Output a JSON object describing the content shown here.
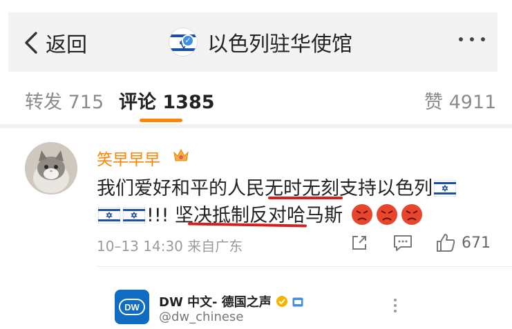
{
  "header": {
    "back_label": "返回",
    "title": "以色列驻华使馆",
    "more_icon": "more-dots-icon"
  },
  "tabs": [
    {
      "label": "转发 715"
    },
    {
      "label": "评论 1385"
    },
    {
      "label": "赞 4911"
    }
  ],
  "comment": {
    "username": "笑早早早",
    "line1_text": "我们爱好和平的人民无时无刻支持以色列",
    "line2_text": "!!! 坚决抵制反对哈马斯",
    "time": "10–13 14:30",
    "location": "来自广东",
    "like_count": "671"
  },
  "card": {
    "name": "DW 中文- 德国之声",
    "handle": "@dw_chinese",
    "logo_text": "DW"
  },
  "colors": {
    "accent": "#ff8200",
    "underline_red": "#d62020",
    "verified_blue": "#3f8fe6",
    "dw_blue": "#0f6cc2"
  }
}
